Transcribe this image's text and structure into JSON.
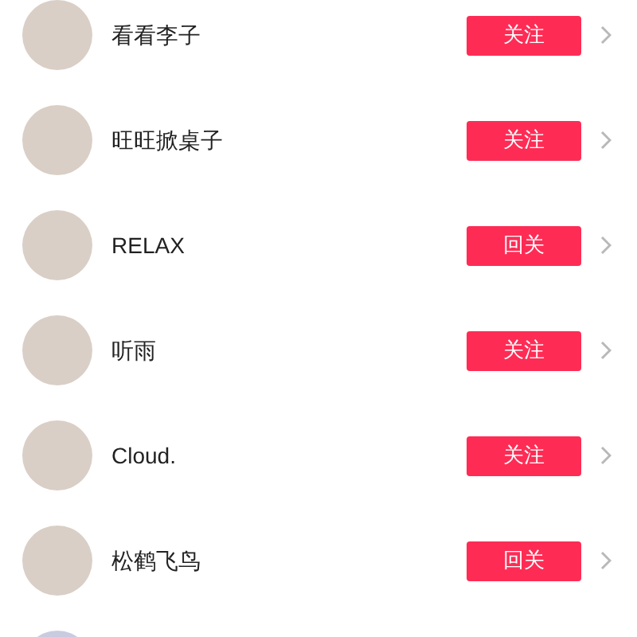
{
  "users": [
    {
      "name": "看看李子",
      "button": "关注"
    },
    {
      "name": "旺旺掀桌子",
      "button": "关注"
    },
    {
      "name": "RELAX",
      "button": "回关"
    },
    {
      "name": "听雨",
      "button": "关注"
    },
    {
      "name": "Cloud.",
      "button": "关注"
    },
    {
      "name": "松鹤飞鸟",
      "button": "回关"
    }
  ]
}
